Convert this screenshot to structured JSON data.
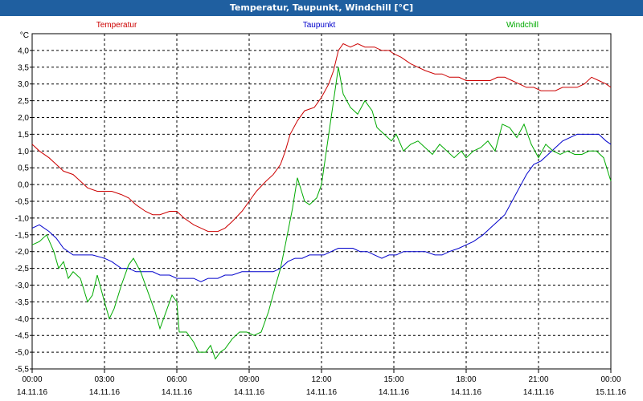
{
  "title": "Temperatur, Taupunkt, Windchill [°C]",
  "chart_data": {
    "type": "line",
    "ylabel": "°C",
    "ylim": [
      -5.5,
      4.5
    ],
    "yticks": [
      -5.5,
      -5.0,
      -4.5,
      -4.0,
      -3.5,
      -3.0,
      -2.5,
      -2.0,
      -1.5,
      -1.0,
      -0.5,
      0.0,
      0.5,
      1.0,
      1.5,
      2.0,
      2.5,
      3.0,
      3.5,
      4.0
    ],
    "ytick_labels": [
      "-5,5",
      "-5,0",
      "-4,5",
      "-4,0",
      "-3,5",
      "-3,0",
      "-2,5",
      "-2,0",
      "-1,5",
      "-1,0",
      "-0,5",
      "0,0",
      "0,5",
      "1,0",
      "1,5",
      "2,0",
      "2,5",
      "3,0",
      "3,5",
      "4,0"
    ],
    "xlim": [
      0,
      24
    ],
    "x_ticks": [
      {
        "time": "00:00",
        "date": "14.11.16"
      },
      {
        "time": "03:00",
        "date": "14.11.16"
      },
      {
        "time": "06:00",
        "date": "14.11.16"
      },
      {
        "time": "09:00",
        "date": "14.11.16"
      },
      {
        "time": "12:00",
        "date": "14.11.16"
      },
      {
        "time": "15:00",
        "date": "14.11.16"
      },
      {
        "time": "18:00",
        "date": "14.11.16"
      },
      {
        "time": "21:00",
        "date": "14.11.16"
      },
      {
        "time": "00:00",
        "date": "15.11.16"
      }
    ],
    "grid": true,
    "series": [
      {
        "name": "Temperatur",
        "color": "#cc0000",
        "points": [
          [
            0,
            1.2
          ],
          [
            0.3,
            1.0
          ],
          [
            0.7,
            0.8
          ],
          [
            1.0,
            0.6
          ],
          [
            1.3,
            0.4
          ],
          [
            1.7,
            0.3
          ],
          [
            2.0,
            0.1
          ],
          [
            2.3,
            -0.1
          ],
          [
            2.7,
            -0.2
          ],
          [
            3.0,
            -0.2
          ],
          [
            3.3,
            -0.2
          ],
          [
            3.7,
            -0.3
          ],
          [
            4.0,
            -0.4
          ],
          [
            4.3,
            -0.6
          ],
          [
            4.7,
            -0.8
          ],
          [
            5.0,
            -0.9
          ],
          [
            5.3,
            -0.9
          ],
          [
            5.7,
            -0.8
          ],
          [
            6.0,
            -0.8
          ],
          [
            6.3,
            -1.0
          ],
          [
            6.7,
            -1.2
          ],
          [
            7.0,
            -1.3
          ],
          [
            7.3,
            -1.4
          ],
          [
            7.7,
            -1.4
          ],
          [
            8.0,
            -1.3
          ],
          [
            8.3,
            -1.1
          ],
          [
            8.7,
            -0.8
          ],
          [
            9.0,
            -0.5
          ],
          [
            9.3,
            -0.2
          ],
          [
            9.7,
            0.1
          ],
          [
            10.0,
            0.3
          ],
          [
            10.3,
            0.6
          ],
          [
            10.5,
            1.0
          ],
          [
            10.7,
            1.5
          ],
          [
            11.0,
            1.9
          ],
          [
            11.3,
            2.2
          ],
          [
            11.7,
            2.3
          ],
          [
            12.0,
            2.6
          ],
          [
            12.3,
            3.0
          ],
          [
            12.5,
            3.4
          ],
          [
            12.7,
            4.0
          ],
          [
            12.9,
            4.2
          ],
          [
            13.2,
            4.1
          ],
          [
            13.5,
            4.2
          ],
          [
            13.8,
            4.1
          ],
          [
            14.2,
            4.1
          ],
          [
            14.5,
            4.0
          ],
          [
            14.8,
            4.0
          ],
          [
            15.0,
            3.9
          ],
          [
            15.3,
            3.8
          ],
          [
            15.7,
            3.6
          ],
          [
            16.0,
            3.5
          ],
          [
            16.3,
            3.4
          ],
          [
            16.7,
            3.3
          ],
          [
            17.0,
            3.3
          ],
          [
            17.3,
            3.2
          ],
          [
            17.7,
            3.2
          ],
          [
            18.0,
            3.1
          ],
          [
            18.3,
            3.1
          ],
          [
            18.7,
            3.1
          ],
          [
            19.0,
            3.1
          ],
          [
            19.3,
            3.2
          ],
          [
            19.6,
            3.2
          ],
          [
            19.9,
            3.1
          ],
          [
            20.2,
            3.0
          ],
          [
            20.5,
            2.9
          ],
          [
            20.8,
            2.9
          ],
          [
            21.1,
            2.8
          ],
          [
            21.4,
            2.8
          ],
          [
            21.7,
            2.8
          ],
          [
            22.0,
            2.9
          ],
          [
            22.3,
            2.9
          ],
          [
            22.6,
            2.9
          ],
          [
            22.9,
            3.0
          ],
          [
            23.2,
            3.2
          ],
          [
            23.5,
            3.1
          ],
          [
            23.8,
            3.0
          ],
          [
            24.0,
            2.9
          ]
        ]
      },
      {
        "name": "Taupunkt",
        "color": "#0000cc",
        "points": [
          [
            0,
            -1.3
          ],
          [
            0.3,
            -1.2
          ],
          [
            0.7,
            -1.4
          ],
          [
            1.0,
            -1.6
          ],
          [
            1.3,
            -1.9
          ],
          [
            1.7,
            -2.1
          ],
          [
            2.0,
            -2.1
          ],
          [
            2.5,
            -2.1
          ],
          [
            3.0,
            -2.2
          ],
          [
            3.3,
            -2.3
          ],
          [
            3.7,
            -2.5
          ],
          [
            4.0,
            -2.5
          ],
          [
            4.3,
            -2.6
          ],
          [
            4.7,
            -2.6
          ],
          [
            5.0,
            -2.6
          ],
          [
            5.3,
            -2.7
          ],
          [
            5.7,
            -2.7
          ],
          [
            6.0,
            -2.8
          ],
          [
            6.3,
            -2.8
          ],
          [
            6.7,
            -2.8
          ],
          [
            7.0,
            -2.9
          ],
          [
            7.3,
            -2.8
          ],
          [
            7.7,
            -2.8
          ],
          [
            8.0,
            -2.7
          ],
          [
            8.3,
            -2.7
          ],
          [
            8.7,
            -2.6
          ],
          [
            9.0,
            -2.6
          ],
          [
            9.3,
            -2.6
          ],
          [
            9.7,
            -2.6
          ],
          [
            10.0,
            -2.6
          ],
          [
            10.3,
            -2.5
          ],
          [
            10.6,
            -2.3
          ],
          [
            10.9,
            -2.2
          ],
          [
            11.2,
            -2.2
          ],
          [
            11.5,
            -2.1
          ],
          [
            11.8,
            -2.1
          ],
          [
            12.1,
            -2.1
          ],
          [
            12.4,
            -2.0
          ],
          [
            12.7,
            -1.9
          ],
          [
            13.0,
            -1.9
          ],
          [
            13.3,
            -1.9
          ],
          [
            13.6,
            -2.0
          ],
          [
            13.9,
            -2.0
          ],
          [
            14.2,
            -2.1
          ],
          [
            14.5,
            -2.2
          ],
          [
            14.8,
            -2.1
          ],
          [
            15.1,
            -2.1
          ],
          [
            15.4,
            -2.0
          ],
          [
            15.7,
            -2.0
          ],
          [
            16.0,
            -2.0
          ],
          [
            16.3,
            -2.0
          ],
          [
            16.7,
            -2.1
          ],
          [
            17.0,
            -2.1
          ],
          [
            17.3,
            -2.0
          ],
          [
            17.7,
            -1.9
          ],
          [
            18.0,
            -1.8
          ],
          [
            18.3,
            -1.7
          ],
          [
            18.7,
            -1.5
          ],
          [
            19.0,
            -1.3
          ],
          [
            19.3,
            -1.1
          ],
          [
            19.6,
            -0.9
          ],
          [
            19.9,
            -0.5
          ],
          [
            20.2,
            -0.1
          ],
          [
            20.5,
            0.3
          ],
          [
            20.8,
            0.6
          ],
          [
            21.1,
            0.7
          ],
          [
            21.4,
            0.9
          ],
          [
            21.7,
            1.1
          ],
          [
            22.0,
            1.3
          ],
          [
            22.3,
            1.4
          ],
          [
            22.6,
            1.5
          ],
          [
            22.9,
            1.5
          ],
          [
            23.2,
            1.5
          ],
          [
            23.5,
            1.5
          ],
          [
            23.8,
            1.3
          ],
          [
            24.0,
            1.2
          ]
        ]
      },
      {
        "name": "Windchill",
        "color": "#00aa00",
        "points": [
          [
            0,
            -1.8
          ],
          [
            0.3,
            -1.7
          ],
          [
            0.6,
            -1.5
          ],
          [
            0.9,
            -2.0
          ],
          [
            1.1,
            -2.5
          ],
          [
            1.3,
            -2.3
          ],
          [
            1.5,
            -2.8
          ],
          [
            1.7,
            -2.6
          ],
          [
            2.0,
            -2.8
          ],
          [
            2.3,
            -3.5
          ],
          [
            2.5,
            -3.3
          ],
          [
            2.7,
            -2.7
          ],
          [
            3.0,
            -3.5
          ],
          [
            3.2,
            -4.0
          ],
          [
            3.4,
            -3.7
          ],
          [
            3.7,
            -3.0
          ],
          [
            4.0,
            -2.4
          ],
          [
            4.2,
            -2.2
          ],
          [
            4.5,
            -2.6
          ],
          [
            4.8,
            -3.2
          ],
          [
            5.1,
            -3.8
          ],
          [
            5.3,
            -4.3
          ],
          [
            5.6,
            -3.7
          ],
          [
            5.8,
            -3.3
          ],
          [
            6.0,
            -3.5
          ],
          [
            6.1,
            -4.4
          ],
          [
            6.4,
            -4.4
          ],
          [
            6.7,
            -4.7
          ],
          [
            6.9,
            -5.0
          ],
          [
            7.2,
            -5.0
          ],
          [
            7.4,
            -4.8
          ],
          [
            7.6,
            -5.2
          ],
          [
            7.8,
            -5.0
          ],
          [
            8.0,
            -4.9
          ],
          [
            8.3,
            -4.6
          ],
          [
            8.6,
            -4.4
          ],
          [
            8.9,
            -4.4
          ],
          [
            9.2,
            -4.5
          ],
          [
            9.5,
            -4.4
          ],
          [
            9.8,
            -3.8
          ],
          [
            10.1,
            -3.0
          ],
          [
            10.3,
            -2.5
          ],
          [
            10.5,
            -1.8
          ],
          [
            10.8,
            -0.7
          ],
          [
            11.0,
            0.2
          ],
          [
            11.3,
            -0.5
          ],
          [
            11.5,
            -0.6
          ],
          [
            11.8,
            -0.4
          ],
          [
            12.0,
            0.0
          ],
          [
            12.3,
            1.5
          ],
          [
            12.5,
            2.5
          ],
          [
            12.7,
            3.5
          ],
          [
            12.9,
            2.7
          ],
          [
            13.2,
            2.3
          ],
          [
            13.5,
            2.1
          ],
          [
            13.8,
            2.5
          ],
          [
            14.1,
            2.2
          ],
          [
            14.3,
            1.7
          ],
          [
            14.6,
            1.5
          ],
          [
            14.9,
            1.3
          ],
          [
            15.1,
            1.5
          ],
          [
            15.4,
            1.0
          ],
          [
            15.7,
            1.2
          ],
          [
            16.0,
            1.3
          ],
          [
            16.3,
            1.1
          ],
          [
            16.6,
            0.9
          ],
          [
            16.9,
            1.2
          ],
          [
            17.2,
            1.0
          ],
          [
            17.5,
            0.8
          ],
          [
            17.8,
            1.0
          ],
          [
            18.0,
            0.8
          ],
          [
            18.3,
            1.0
          ],
          [
            18.6,
            1.1
          ],
          [
            18.9,
            1.3
          ],
          [
            19.2,
            1.0
          ],
          [
            19.5,
            1.8
          ],
          [
            19.8,
            1.7
          ],
          [
            20.1,
            1.4
          ],
          [
            20.4,
            1.8
          ],
          [
            20.7,
            1.2
          ],
          [
            21.0,
            0.8
          ],
          [
            21.3,
            1.2
          ],
          [
            21.6,
            1.0
          ],
          [
            21.9,
            0.9
          ],
          [
            22.2,
            1.0
          ],
          [
            22.5,
            0.9
          ],
          [
            22.8,
            0.9
          ],
          [
            23.1,
            1.0
          ],
          [
            23.4,
            1.0
          ],
          [
            23.7,
            0.8
          ],
          [
            24.0,
            0.1
          ]
        ]
      }
    ]
  }
}
